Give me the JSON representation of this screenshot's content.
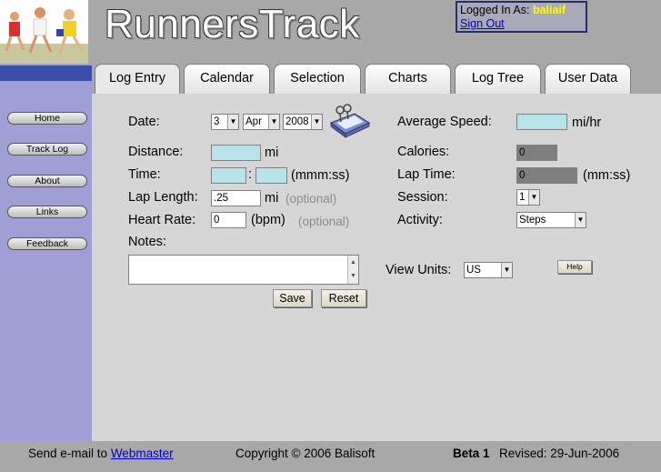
{
  "header": {
    "site_title": "RunnersTrack",
    "login_label": "Logged In As:",
    "username": "baliaif",
    "sign_out": "Sign Out"
  },
  "left_nav": [
    "Home",
    "Track Log",
    "About",
    "Links",
    "Feedback"
  ],
  "tabs": [
    "Log Entry",
    "Calendar",
    "Selection",
    "Charts",
    "Log Tree",
    "User Data"
  ],
  "form": {
    "date_label": "Date:",
    "date_day": "3",
    "date_month": "Apr",
    "date_year": "2008",
    "distance_label": "Distance:",
    "distance_unit": "mi",
    "time_label": "Time:",
    "time_sep": ":",
    "time_unit": "(mmm:ss)",
    "lap_length_label": "Lap Length:",
    "lap_length_value": ".25",
    "lap_length_unit": "mi",
    "optional_1": "(optional)",
    "heart_rate_label": "Heart Rate:",
    "heart_rate_value": "0",
    "heart_rate_unit": "(bpm)",
    "optional_2": "(optional)",
    "notes_label": "Notes:",
    "avg_speed_label": "Average Speed:",
    "avg_speed_unit": "mi/hr",
    "calories_label": "Calories:",
    "calories_value": "0",
    "lap_time_label": "Lap Time:",
    "lap_time_value": "0",
    "lap_time_unit": "(mm:ss)",
    "session_label": "Session:",
    "session_value": "1",
    "activity_label": "Activity:",
    "activity_value": "Steps",
    "view_units_label": "View Units:",
    "view_units_value": "US",
    "help": "Help",
    "save": "Save",
    "reset": "Reset"
  },
  "footer": {
    "email_text": "Send e-mail to",
    "webmaster": "Webmaster",
    "copyright": "Copyright © 2006 Balisoft",
    "beta": "Beta 1",
    "revised": "Revised: 29-Jun-2006"
  },
  "colors": {
    "header_bg": "#a8a8a8",
    "nav_bg": "#9f9fd6",
    "nav_bar": "#3b4fa8",
    "content_bg": "#d6d6d6",
    "input_cyan": "#b9e3ea",
    "username": "#ffff00",
    "link": "#0000cc"
  },
  "icons": {
    "logo": "runners-logo-icon",
    "calendar": "calendar-icon"
  }
}
